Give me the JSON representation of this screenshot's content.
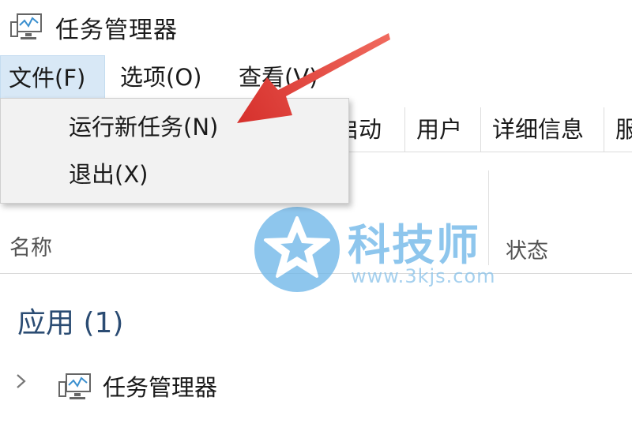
{
  "window": {
    "title": "任务管理器",
    "icon": "task-manager-icon"
  },
  "menubar": {
    "file": "文件(F)",
    "options": "选项(O)",
    "view": "查看(V)"
  },
  "tabs": {
    "startup": "启动",
    "users": "用户",
    "details": "详细信息",
    "services": "服"
  },
  "file_menu": {
    "items": [
      "运行新任务(N)",
      "退出(X)"
    ]
  },
  "columns": {
    "name": "名称",
    "status": "状态"
  },
  "apps_group": {
    "label": "应用 (1)"
  },
  "app_rows": [
    {
      "label": "任务管理器",
      "icon": "task-manager-icon"
    }
  ],
  "watermark": {
    "brand": "科技师",
    "url": "www.3kjs.com"
  },
  "colors": {
    "menu_highlight": "#d8e8f6",
    "arrow": "#e0403c",
    "group_text": "#2b4c73",
    "watermark": "#6fb7e8"
  }
}
